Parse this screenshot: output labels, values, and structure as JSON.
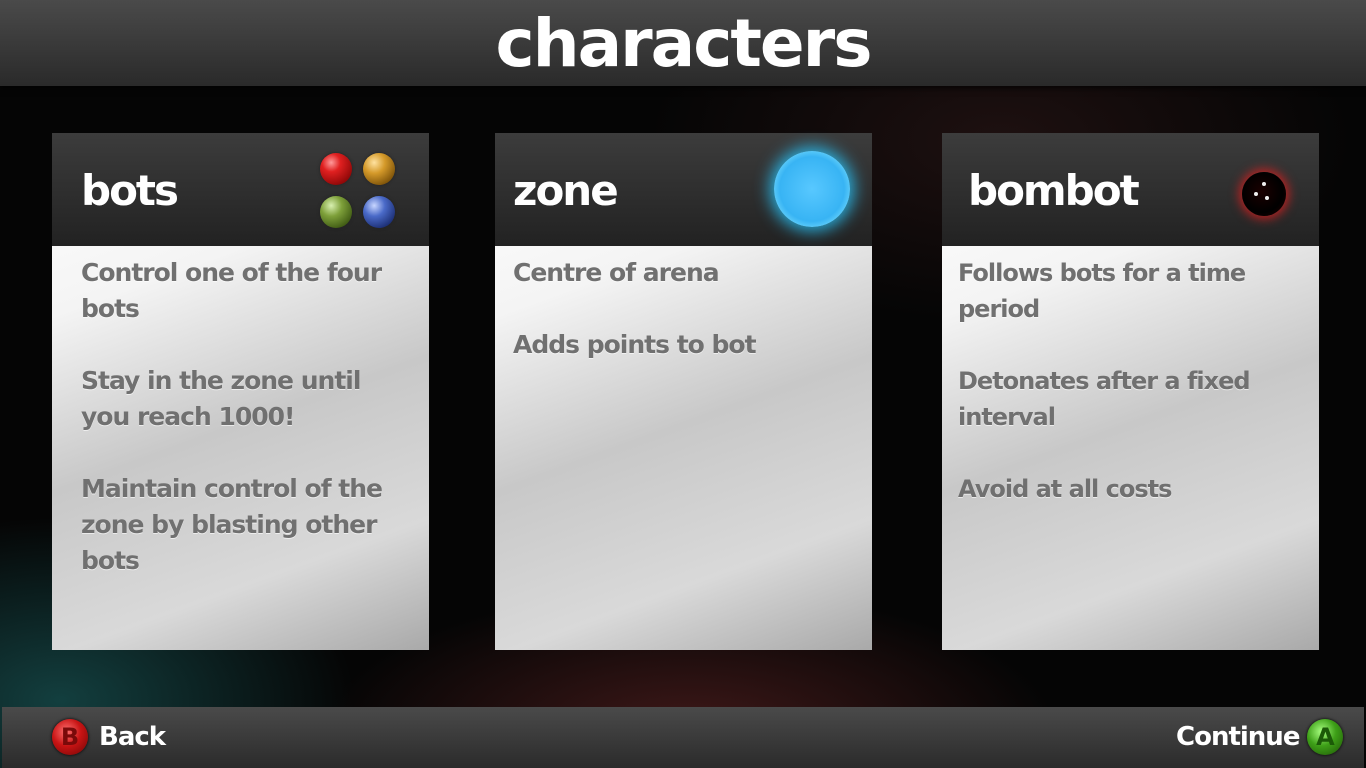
{
  "header": {
    "title": "characters"
  },
  "cards": [
    {
      "title": "bots",
      "icon": "four-bots-icon",
      "lines": [
        "Control one of the four bots",
        "Stay in the zone until you reach 1000!",
        "Maintain control of the zone by blasting other bots"
      ]
    },
    {
      "title": "zone",
      "icon": "zone-orb-icon",
      "lines": [
        "Centre of arena",
        "Adds points to bot"
      ]
    },
    {
      "title": "bombot",
      "icon": "bombot-icon",
      "lines": [
        "Follows bots for a time period",
        "Detonates after a fixed interval",
        "Avoid at all costs"
      ]
    }
  ],
  "footer": {
    "back_label": "Back",
    "back_button_glyph": "B",
    "continue_label": "Continue",
    "continue_button_glyph": "A"
  },
  "colors": {
    "header_bar": "#3a3a3a",
    "card_text": "#707070",
    "zone_glow": "#38b4f4",
    "bombot_glow": "#e61e1e",
    "b_button": "#c81414",
    "a_button": "#3ea018"
  }
}
